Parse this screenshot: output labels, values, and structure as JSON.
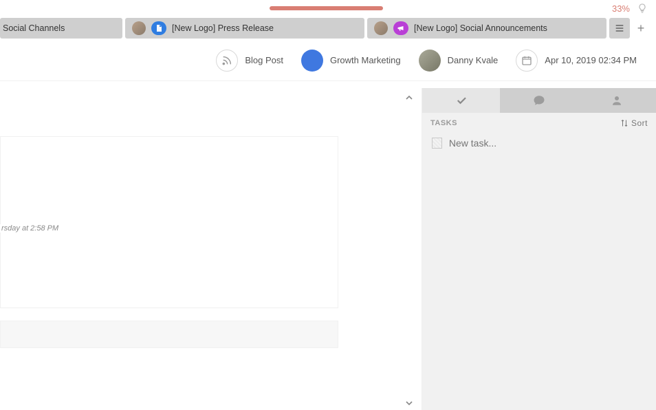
{
  "progress": {
    "percent_label": "33%",
    "percent_value": 33
  },
  "tabs": [
    {
      "label": "Social Channels"
    },
    {
      "label": "[New Logo] Press Release",
      "badge": "doc",
      "badge_color": "blue"
    },
    {
      "label": "[New Logo] Social Announcements",
      "badge": "megaphone",
      "badge_color": "purple"
    }
  ],
  "meta": {
    "post_type": "Blog Post",
    "category": "Growth Marketing",
    "category_color": "#3f78e0",
    "author": "Danny Kvale",
    "datetime": "Apr 10, 2019 02:34 PM"
  },
  "left": {
    "timestamp_fragment": "rsday at 2:58 PM"
  },
  "side_panel": {
    "tasks_label": "TASKS",
    "sort_label": "Sort",
    "new_task_placeholder": "New task..."
  }
}
